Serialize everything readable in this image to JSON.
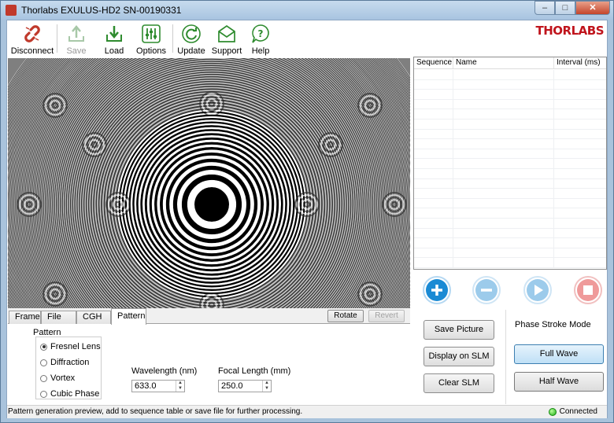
{
  "window": {
    "title": "Thorlabs EXULUS-HD2 SN-00190331"
  },
  "toolbar": {
    "disconnect": "Disconnect",
    "save": "Save",
    "load": "Load",
    "options": "Options",
    "update": "Update",
    "support": "Support",
    "help": "Help"
  },
  "logo": "THORLABS",
  "sequence_table": {
    "col_sequence": "Sequence",
    "col_name": "Name",
    "col_interval": "Interval (ms)"
  },
  "tabs": [
    "Frame",
    "File",
    "CGH",
    "Pattern"
  ],
  "tab_buttons": {
    "rotate": "Rotate",
    "revert": "Revert"
  },
  "pattern": {
    "group_label": "Pattern",
    "options": [
      "Fresnel Lens",
      "Diffraction",
      "Vortex",
      "Cubic Phase"
    ],
    "wavelength_label": "Wavelength (nm)",
    "wavelength_value": "633.0",
    "focal_label": "Focal Length (mm)",
    "focal_value": "250.0"
  },
  "actions": {
    "save_picture": "Save Picture",
    "display_on_slm": "Display on SLM",
    "clear_slm": "Clear SLM"
  },
  "phase_stroke": {
    "label": "Phase Stroke Mode",
    "full_wave": "Full Wave",
    "half_wave": "Half Wave"
  },
  "status": {
    "message": "Pattern generation preview, add to sequence table or save file for further processing.",
    "connection": "Connected"
  }
}
